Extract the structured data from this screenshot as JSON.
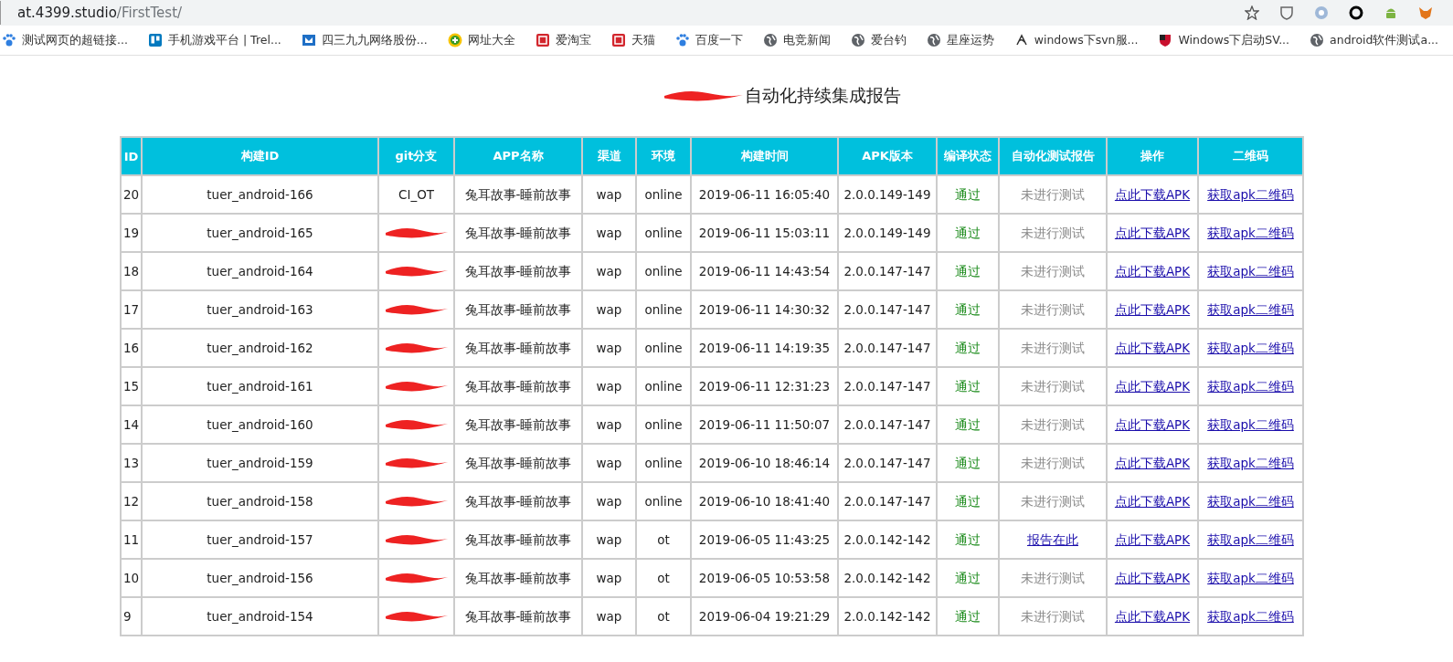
{
  "address_bar": {
    "host": "at.4399.studio",
    "path": "/FirstTest/"
  },
  "bookmarks": [
    {
      "kind": "paw",
      "label": "测试网页的超链接..."
    },
    {
      "kind": "board",
      "label": "手机游戏平台 | Trel..."
    },
    {
      "kind": "box",
      "label": "四三九九网络股份..."
    },
    {
      "kind": "plus",
      "label": "网址大全"
    },
    {
      "kind": "tag",
      "label": "爱淘宝"
    },
    {
      "kind": "tag",
      "label": "天猫"
    },
    {
      "kind": "paw",
      "label": "百度一下"
    },
    {
      "kind": "globe",
      "label": "电竞新闻"
    },
    {
      "kind": "globe",
      "label": "爱台钓"
    },
    {
      "kind": "globe",
      "label": "星座运势"
    },
    {
      "kind": "swirl",
      "label": "windows下svn服..."
    },
    {
      "kind": "shield",
      "label": "Windows下启动SV..."
    },
    {
      "kind": "globe",
      "label": "android软件测试a..."
    }
  ],
  "title": {
    "text": "自动化持续集成报告",
    "redacted_prefix": true
  },
  "table": {
    "columns": [
      "ID",
      "构建ID",
      "git分支",
      "APP名称",
      "渠道",
      "环境",
      "构建时间",
      "APK版本",
      "编译状态",
      "自动化测试报告",
      "操作",
      "二维码"
    ],
    "rows": [
      {
        "id": "20",
        "build_id": "tuer_android-166",
        "redacted": false,
        "git_branch": "CI_OT",
        "app": "兔耳故事-睡前故事",
        "channel": "wap",
        "env": "online",
        "time": "2019-06-11 16:05:40",
        "apk": "2.0.0.149-149",
        "status": "通过",
        "report": {
          "text": "未进行测试",
          "link": false
        },
        "action": "点此下载APK",
        "qr": "获取apk二维码"
      },
      {
        "id": "19",
        "build_id": "tuer_android-165",
        "redacted": true,
        "app": "兔耳故事-睡前故事",
        "channel": "wap",
        "env": "online",
        "time": "2019-06-11 15:03:11",
        "apk": "2.0.0.149-149",
        "status": "通过",
        "report": {
          "text": "未进行测试",
          "link": false
        },
        "action": "点此下载APK",
        "qr": "获取apk二维码"
      },
      {
        "id": "18",
        "build_id": "tuer_android-164",
        "redacted": true,
        "app": "兔耳故事-睡前故事",
        "channel": "wap",
        "env": "online",
        "time": "2019-06-11 14:43:54",
        "apk": "2.0.0.147-147",
        "status": "通过",
        "report": {
          "text": "未进行测试",
          "link": false
        },
        "action": "点此下载APK",
        "qr": "获取apk二维码"
      },
      {
        "id": "17",
        "build_id": "tuer_android-163",
        "redacted": true,
        "app": "兔耳故事-睡前故事",
        "channel": "wap",
        "env": "online",
        "time": "2019-06-11 14:30:32",
        "apk": "2.0.0.147-147",
        "status": "通过",
        "report": {
          "text": "未进行测试",
          "link": false
        },
        "action": "点此下载APK",
        "qr": "获取apk二维码"
      },
      {
        "id": "16",
        "build_id": "tuer_android-162",
        "redacted": true,
        "app": "兔耳故事-睡前故事",
        "channel": "wap",
        "env": "online",
        "time": "2019-06-11 14:19:35",
        "apk": "2.0.0.147-147",
        "status": "通过",
        "report": {
          "text": "未进行测试",
          "link": false
        },
        "action": "点此下载APK",
        "qr": "获取apk二维码"
      },
      {
        "id": "15",
        "build_id": "tuer_android-161",
        "redacted": true,
        "app": "兔耳故事-睡前故事",
        "channel": "wap",
        "env": "online",
        "time": "2019-06-11 12:31:23",
        "apk": "2.0.0.147-147",
        "status": "通过",
        "report": {
          "text": "未进行测试",
          "link": false
        },
        "action": "点此下载APK",
        "qr": "获取apk二维码"
      },
      {
        "id": "14",
        "build_id": "tuer_android-160",
        "redacted": true,
        "app": "兔耳故事-睡前故事",
        "channel": "wap",
        "env": "online",
        "time": "2019-06-11 11:50:07",
        "apk": "2.0.0.147-147",
        "status": "通过",
        "report": {
          "text": "未进行测试",
          "link": false
        },
        "action": "点此下载APK",
        "qr": "获取apk二维码"
      },
      {
        "id": "13",
        "build_id": "tuer_android-159",
        "redacted": true,
        "app": "兔耳故事-睡前故事",
        "channel": "wap",
        "env": "online",
        "time": "2019-06-10 18:46:14",
        "apk": "2.0.0.147-147",
        "status": "通过",
        "report": {
          "text": "未进行测试",
          "link": false
        },
        "action": "点此下载APK",
        "qr": "获取apk二维码"
      },
      {
        "id": "12",
        "build_id": "tuer_android-158",
        "redacted": true,
        "app": "兔耳故事-睡前故事",
        "channel": "wap",
        "env": "online",
        "time": "2019-06-10 18:41:40",
        "apk": "2.0.0.147-147",
        "status": "通过",
        "report": {
          "text": "未进行测试",
          "link": false
        },
        "action": "点此下载APK",
        "qr": "获取apk二维码"
      },
      {
        "id": "11",
        "build_id": "tuer_android-157",
        "redacted": true,
        "app": "兔耳故事-睡前故事",
        "channel": "wap",
        "env": "ot",
        "time": "2019-06-05 11:43:25",
        "apk": "2.0.0.142-142",
        "status": "通过",
        "report": {
          "text": "报告在此",
          "link": true
        },
        "action": "点此下载APK",
        "qr": "获取apk二维码"
      },
      {
        "id": "10",
        "build_id": "tuer_android-156",
        "redacted": true,
        "app": "兔耳故事-睡前故事",
        "channel": "wap",
        "env": "ot",
        "time": "2019-06-05 10:53:58",
        "apk": "2.0.0.142-142",
        "status": "通过",
        "report": {
          "text": "未进行测试",
          "link": false
        },
        "action": "点此下载APK",
        "qr": "获取apk二维码"
      },
      {
        "id": "9",
        "build_id": "tuer_android-154",
        "redacted": true,
        "app": "兔耳故事-睡前故事",
        "channel": "wap",
        "env": "ot",
        "time": "2019-06-04 19:21:29",
        "apk": "2.0.0.142-142",
        "status": "通过",
        "report": {
          "text": "未进行测试",
          "link": false
        },
        "action": "点此下载APK",
        "qr": "获取apk二维码"
      }
    ]
  }
}
